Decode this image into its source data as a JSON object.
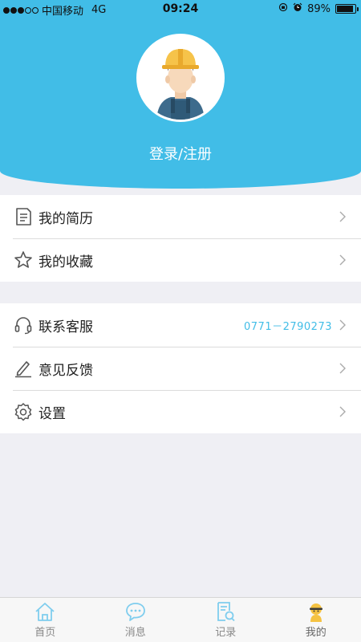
{
  "status_bar": {
    "carrier": "中国移动",
    "network": "4G",
    "time": "09:24",
    "battery": "89%",
    "battery_level": 0.89,
    "signal_bars": 3
  },
  "header": {
    "login_label": "登录/注册",
    "background_color": "#41bde7"
  },
  "menu_groups": [
    {
      "items": [
        {
          "icon": "resume-icon",
          "label": "我的简历"
        },
        {
          "icon": "star-icon",
          "label": "我的收藏"
        }
      ]
    },
    {
      "items": [
        {
          "icon": "headset-icon",
          "label": "联系客服",
          "value": "0771－2790273"
        },
        {
          "icon": "edit-icon",
          "label": "意见反馈"
        },
        {
          "icon": "settings-icon",
          "label": "设置"
        }
      ]
    }
  ],
  "tabbar": {
    "tabs": [
      {
        "icon": "home-icon",
        "label": "首页"
      },
      {
        "icon": "message-icon",
        "label": "消息"
      },
      {
        "icon": "record-icon",
        "label": "记录"
      },
      {
        "icon": "profile-icon",
        "label": "我的",
        "active": true
      }
    ],
    "active_color": "#f5c242",
    "inactive_color": "#7fcdee"
  }
}
